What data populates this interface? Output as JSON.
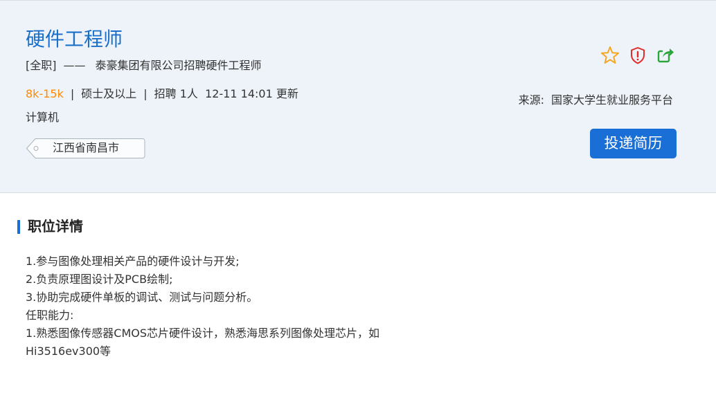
{
  "job": {
    "title": "硬件工程师",
    "type": "[全职]",
    "dash": "——",
    "company_line": "泰豪集团有限公司招聘硬件工程师",
    "salary": "8k-15k",
    "separator": "|",
    "education": "硕士及以上",
    "headcount": "招聘 1人",
    "updated": "12-11 14:01 更新",
    "major": "计算机",
    "location": "江西省南昌市"
  },
  "actions": {
    "icons": [
      "star-icon",
      "shield-alert-icon",
      "share-icon"
    ],
    "apply_label": "投递简历"
  },
  "source": {
    "label": "来源:",
    "value": "国家大学生就业服务平台"
  },
  "details": {
    "section_title": "职位详情",
    "lines": [
      "1.参与图像处理相关产品的硬件设计与开发;",
      "2.负责原理图设计及PCB绘制;",
      "3.协助完成硬件单板的调试、测试与问题分析。",
      "任职能力:",
      "1.熟悉图像传感器CMOS芯片硬件设计，熟悉海思系列图像处理芯片，如",
      "Hi3516ev300等"
    ]
  },
  "colors": {
    "accent": "#1a6fd6",
    "title": "#1a6fc9",
    "salary": "#ff8a00",
    "star": "#f5a623",
    "alert": "#e02b2b",
    "share": "#2aa63a",
    "header_bg": "#edf3f8"
  }
}
